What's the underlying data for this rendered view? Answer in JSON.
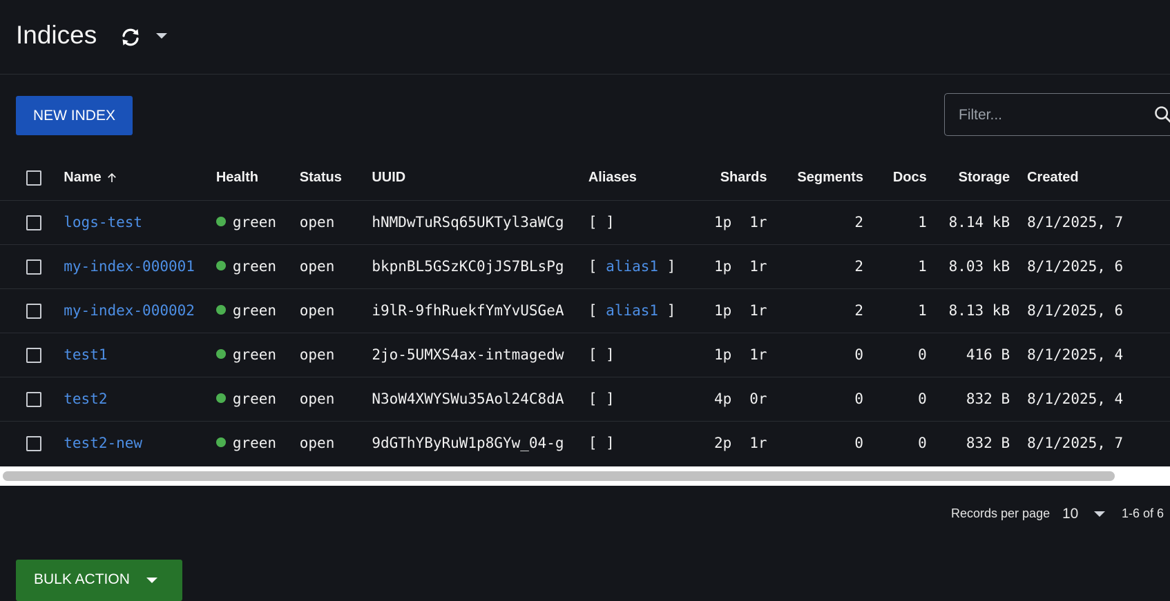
{
  "header": {
    "title": "Indices"
  },
  "toolbar": {
    "new_index_label": "NEW INDEX",
    "filter_placeholder": "Filter..."
  },
  "table": {
    "columns": {
      "name": "Name",
      "health": "Health",
      "status": "Status",
      "uuid": "UUID",
      "aliases": "Aliases",
      "shards": "Shards",
      "segments": "Segments",
      "docs": "Docs",
      "storage": "Storage",
      "created": "Created"
    },
    "rows": [
      {
        "name": "logs-test",
        "health": "green",
        "status": "open",
        "uuid": "hNMDwTuRSq65UKTyl3aWCg",
        "alias_open": "[",
        "alias": "",
        "alias_close": "]",
        "primaries": "1p",
        "replicas": "1r",
        "segments": "2",
        "docs": "1",
        "storage": "8.14 kB",
        "created": "8/1/2025, 7"
      },
      {
        "name": "my-index-000001",
        "health": "green",
        "status": "open",
        "uuid": "bkpnBL5GSzKC0jJS7BLsPg",
        "alias_open": "[",
        "alias": "alias1",
        "alias_close": "]",
        "primaries": "1p",
        "replicas": "1r",
        "segments": "2",
        "docs": "1",
        "storage": "8.03 kB",
        "created": "8/1/2025, 6"
      },
      {
        "name": "my-index-000002",
        "health": "green",
        "status": "open",
        "uuid": "i9lR-9fhRuekfYmYvUSGeA",
        "alias_open": "[",
        "alias": "alias1",
        "alias_close": "]",
        "primaries": "1p",
        "replicas": "1r",
        "segments": "2",
        "docs": "1",
        "storage": "8.13 kB",
        "created": "8/1/2025, 6"
      },
      {
        "name": "test1",
        "health": "green",
        "status": "open",
        "uuid": "2jo-5UMXS4ax-intmagedw",
        "alias_open": "[",
        "alias": "",
        "alias_close": "]",
        "primaries": "1p",
        "replicas": "1r",
        "segments": "0",
        "docs": "0",
        "storage": "416 B",
        "created": "8/1/2025, 4"
      },
      {
        "name": "test2",
        "health": "green",
        "status": "open",
        "uuid": "N3oW4XWYSWu35Aol24C8dA",
        "alias_open": "[",
        "alias": "",
        "alias_close": "]",
        "primaries": "4p",
        "replicas": "0r",
        "segments": "0",
        "docs": "0",
        "storage": "832 B",
        "created": "8/1/2025, 4"
      },
      {
        "name": "test2-new",
        "health": "green",
        "status": "open",
        "uuid": "9dGThYByRuW1p8GYw_04-g",
        "alias_open": "[",
        "alias": "",
        "alias_close": "]",
        "primaries": "2p",
        "replicas": "1r",
        "segments": "0",
        "docs": "0",
        "storage": "832 B",
        "created": "8/1/2025, 7"
      }
    ]
  },
  "pagination": {
    "records_per_page_label": "Records per page",
    "records_per_page": "10",
    "range": "1-6 of 6"
  },
  "bulk": {
    "label": "BULK ACTION"
  },
  "colors": {
    "background": "#14161b",
    "link": "#4d8fe6",
    "health_green": "#4caf50",
    "primary_button": "#1a52b8",
    "bulk_button": "#26732a"
  },
  "icons": {
    "refresh": "refresh-icon",
    "search": "search-icon",
    "sort": "arrow-up-icon",
    "caret": "chevron-down-icon"
  }
}
